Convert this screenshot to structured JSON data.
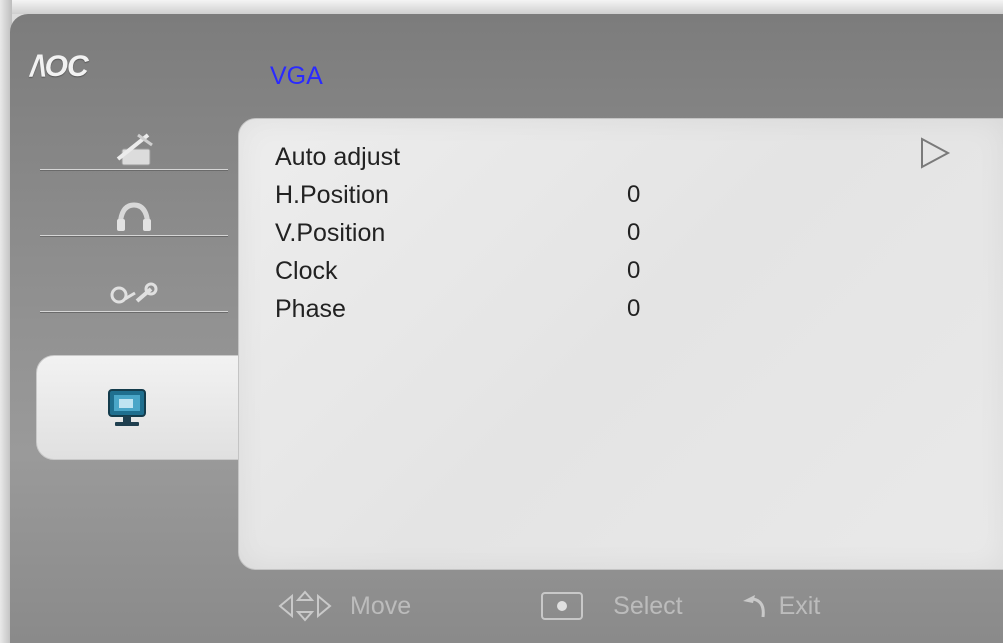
{
  "brand": {
    "logo": "/\\OC"
  },
  "header": {
    "title": "VGA"
  },
  "sidebar": {
    "items": [
      {
        "icon": "picture-tools-icon"
      },
      {
        "icon": "audio-icon"
      },
      {
        "icon": "tools-icon"
      },
      {
        "icon": "monitor-pc-icon",
        "active": true
      }
    ]
  },
  "menu": {
    "rows": [
      {
        "label": "Auto adjust",
        "value": ""
      },
      {
        "label": "H.Position",
        "value": "0"
      },
      {
        "label": "V.Position",
        "value": "0"
      },
      {
        "label": "Clock",
        "value": "0"
      },
      {
        "label": "Phase",
        "value": "0"
      }
    ],
    "indicator": "right-triangle-icon"
  },
  "footer": {
    "move_label": "Move",
    "select_label": "Select",
    "exit_label": "Exit"
  },
  "colors": {
    "title": "#2a2aff",
    "panel": "#e8e8e8",
    "osd_background": "#8a8a8a"
  }
}
